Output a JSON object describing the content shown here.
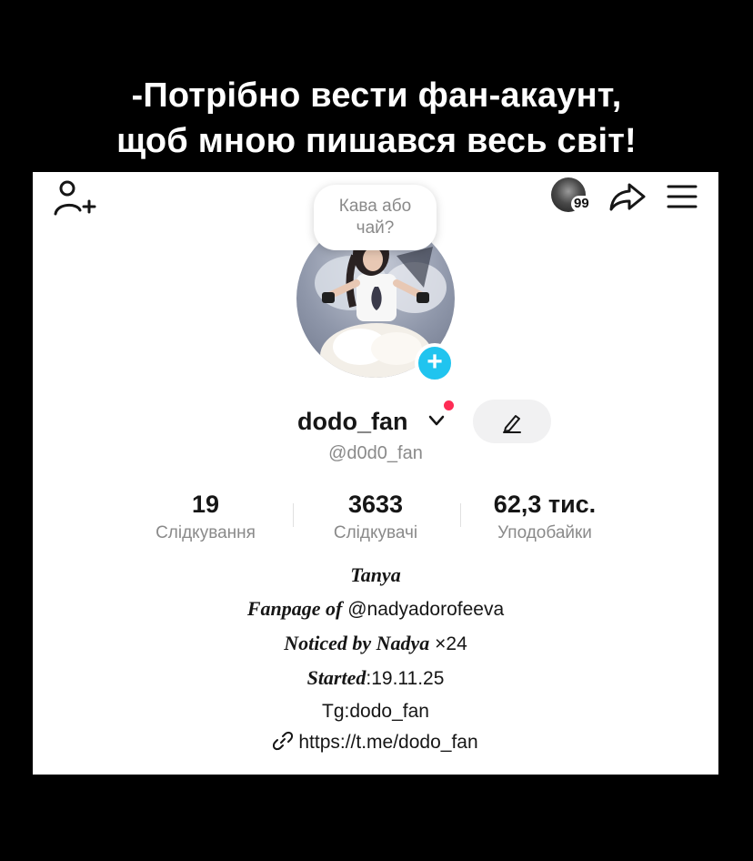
{
  "caption": {
    "line1": "-Потрібно вести фан-акаунт,",
    "line2": "щоб мною пишався весь світ!"
  },
  "topbar": {
    "story_count": "99",
    "icons": [
      "add-friend-icon",
      "share-icon",
      "menu-icon"
    ]
  },
  "note_bubble": {
    "line1": "Кава або",
    "line2": "чай?"
  },
  "profile": {
    "username": "dodo_fan",
    "handle": "@d0d0_fan"
  },
  "stats": {
    "following": {
      "value": "19",
      "label": "Слідкування"
    },
    "followers": {
      "value": "3633",
      "label": "Слідкувачі"
    },
    "likes": {
      "value": "62,3 тис.",
      "label": "Уподобайки"
    }
  },
  "bio": {
    "line1": "Tanya",
    "line2_prefix": "Fanpage of",
    "line2_mention": "@nadyadorofeeva",
    "line3_prefix": "Noticed by Nadya",
    "line3_count": "×24",
    "line4_prefix": "Started",
    "line4_date": ":19.11.25",
    "line5": "Tg:dodo_fan"
  },
  "link": {
    "url": "https://t.me/dodo_fan"
  },
  "colors": {
    "accent_plus": "#20c4ef",
    "notification_dot": "#fe2c55",
    "muted_text": "#8a8a8a"
  }
}
